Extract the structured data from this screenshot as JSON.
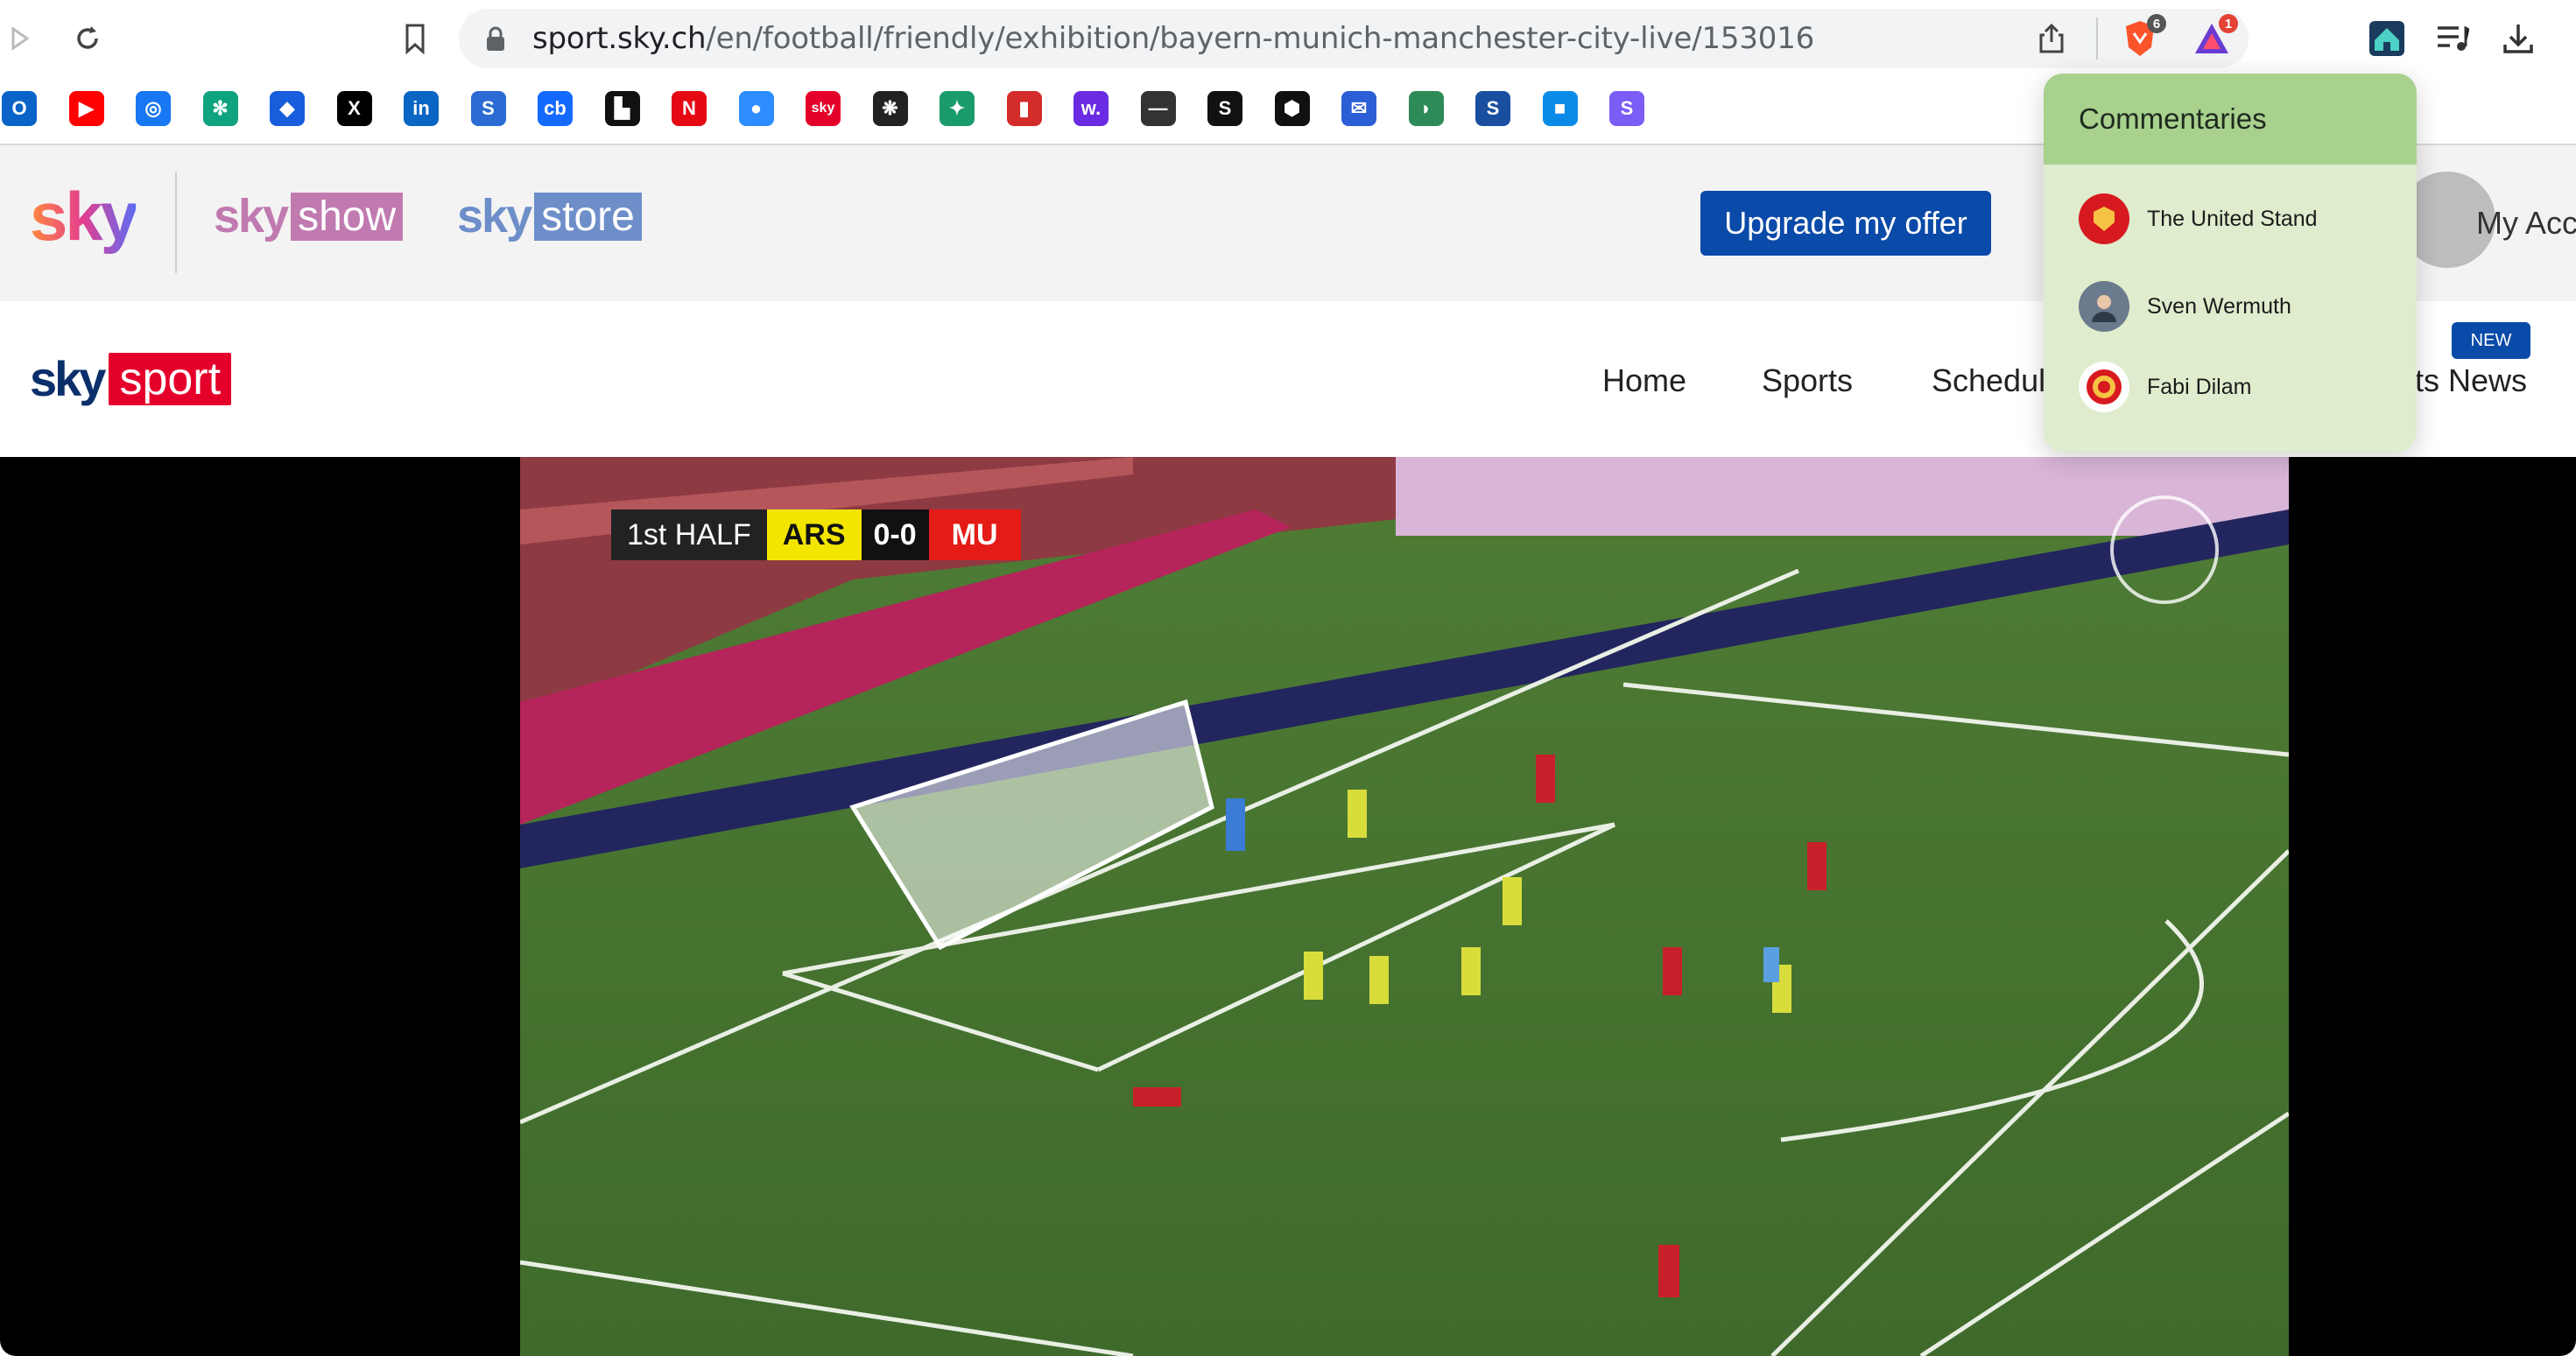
{
  "browser": {
    "url_host": "sport.sky.ch",
    "url_path": "/en/football/friendly/exhibition/bayern-munich-manchester-city-live/153016",
    "brave_badge": "6",
    "alert_badge": "1"
  },
  "bookmarks": [
    {
      "icon": "outlook-icon",
      "text": "O",
      "color": "#0a64c8"
    },
    {
      "icon": "youtube-icon",
      "text": "▶",
      "color": "#ff0000"
    },
    {
      "icon": "messenger-icon",
      "text": "◎",
      "color": "#1877f2"
    },
    {
      "icon": "chatgpt-icon",
      "text": "✻",
      "color": "#10a37f"
    },
    {
      "icon": "bitwarden-icon",
      "text": "◆",
      "color": "#175ddc"
    },
    {
      "icon": "x-icon",
      "text": "X",
      "color": "#000000"
    },
    {
      "icon": "linkedin-icon",
      "text": "in",
      "color": "#0a66c2"
    },
    {
      "icon": "stack-icon",
      "text": "S",
      "color": "#2b6cd4"
    },
    {
      "icon": "crunchbase-icon",
      "text": "cb",
      "color": "#146aff"
    },
    {
      "icon": "unsplash-icon",
      "text": "▙",
      "color": "#111111"
    },
    {
      "icon": "netflix-icon",
      "text": "N",
      "color": "#e50914"
    },
    {
      "icon": "pin-icon",
      "text": "●",
      "color": "#2d8cff"
    },
    {
      "icon": "sky-icon",
      "text": "sky",
      "color": "#e5002b"
    },
    {
      "icon": "flower-icon",
      "text": "❋",
      "color": "#222222"
    },
    {
      "icon": "bird-icon",
      "text": "✦",
      "color": "#1a9b6b"
    },
    {
      "icon": "chart-icon",
      "text": "▮",
      "color": "#d42b2b"
    },
    {
      "icon": "w-icon",
      "text": "w.",
      "color": "#6a2be2"
    },
    {
      "icon": "dash-icon",
      "text": "—",
      "color": "#333333"
    },
    {
      "icon": "s-icon",
      "text": "S",
      "color": "#111111"
    },
    {
      "icon": "cube-icon",
      "text": "⬢",
      "color": "#111111"
    },
    {
      "icon": "mail-icon",
      "text": "✉",
      "color": "#2c5fd6"
    },
    {
      "icon": "leaf-icon",
      "text": "◗",
      "color": "#2e8b57"
    },
    {
      "icon": "s-curve-icon",
      "text": "S",
      "color": "#1a4fa0"
    },
    {
      "icon": "square-icon",
      "text": "■",
      "color": "#0b8be8"
    },
    {
      "icon": "s-purple-icon",
      "text": "S",
      "color": "#7b5cf5"
    }
  ],
  "skybar": {
    "sky": "sky",
    "show_prefix": "sky",
    "show": "show",
    "store_prefix": "sky",
    "store": "store",
    "upgrade_label": "Upgrade my offer",
    "account_label": "My Acco"
  },
  "sport": {
    "logo_sky": "sky",
    "logo_sport": "sport",
    "nav": [
      "Home",
      "Sports",
      "Schedul",
      "ts News"
    ],
    "new_badge": "NEW"
  },
  "video": {
    "half": "1st HALF",
    "home": "ARS",
    "score": "0-0",
    "away": "MU"
  },
  "commentaries": {
    "title": "Commentaries",
    "items": [
      {
        "name": "The United Stand",
        "color": "#d71920"
      },
      {
        "name": "Sven Wermuth",
        "color": "#6b7a8c"
      },
      {
        "name": "Fabi Dilam",
        "color": "#ffffff"
      }
    ]
  }
}
